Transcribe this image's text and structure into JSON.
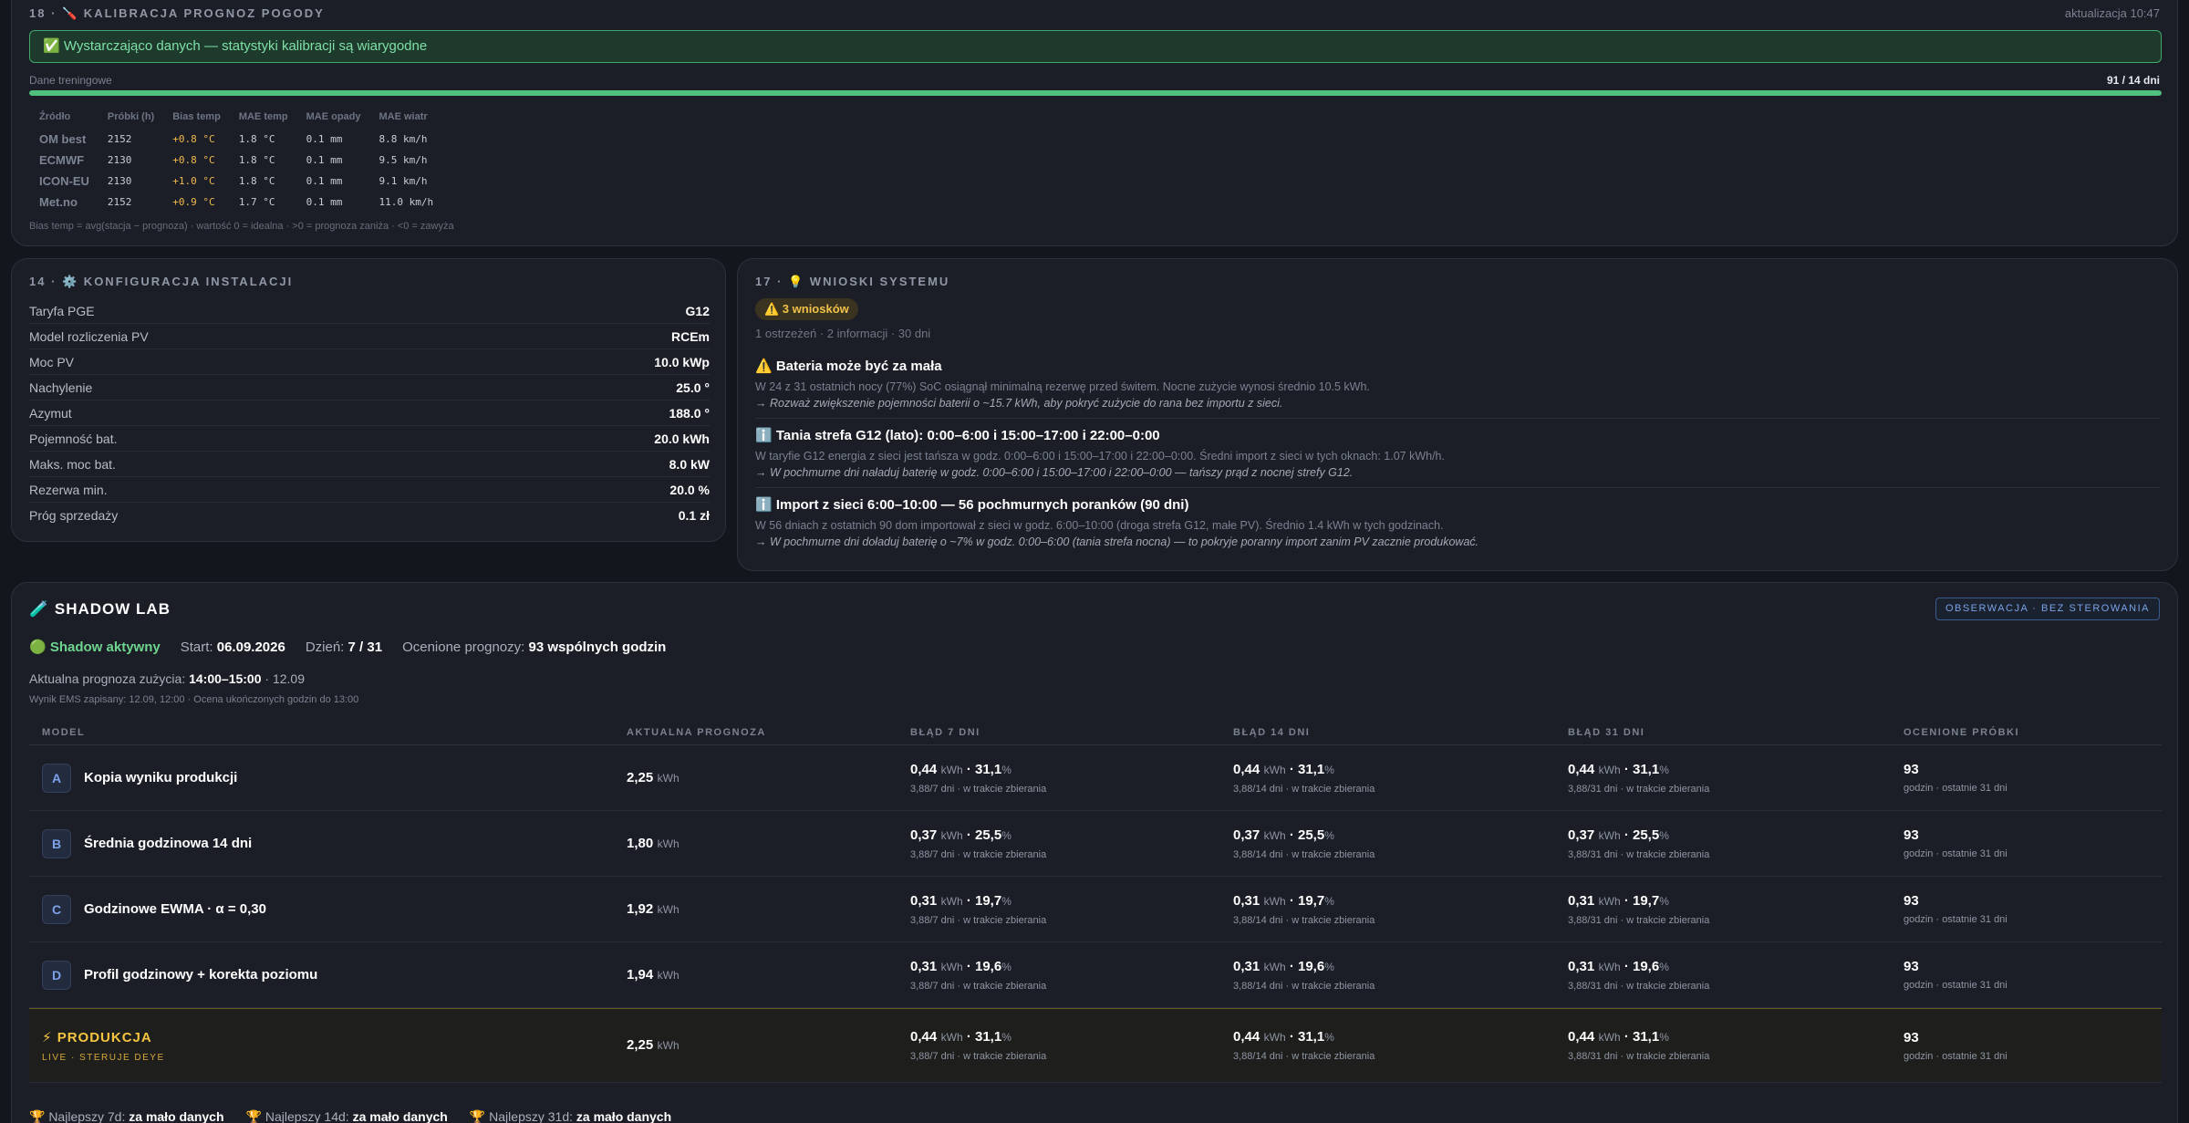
{
  "calibration": {
    "title": "18 · 🪛 KALIBRACJA PROGNOZ POGODY",
    "updated": "aktualizacja 10:47",
    "banner": "✅ Wystarczająco danych — statystyki kalibracji są wiarygodne",
    "training_label": "Dane treningowe",
    "training_value": "91 / 14 dni",
    "training_progress": 1.0,
    "columns": [
      "Źródło",
      "Próbki (h)",
      "Bias temp",
      "MAE temp",
      "MAE opady",
      "MAE wiatr"
    ],
    "rows": [
      {
        "source": "OM best",
        "samples": "2152",
        "bias": "+0.8 °C",
        "mae_temp": "1.8 °C",
        "mae_rain": "0.1 mm",
        "mae_wind": "8.8 km/h"
      },
      {
        "source": "ECMWF",
        "samples": "2130",
        "bias": "+0.8 °C",
        "mae_temp": "1.8 °C",
        "mae_rain": "0.1 mm",
        "mae_wind": "9.5 km/h"
      },
      {
        "source": "ICON-EU",
        "samples": "2130",
        "bias": "+1.0 °C",
        "mae_temp": "1.8 °C",
        "mae_rain": "0.1 mm",
        "mae_wind": "9.1 km/h"
      },
      {
        "source": "Met.no",
        "samples": "2152",
        "bias": "+0.9 °C",
        "mae_temp": "1.7 °C",
        "mae_rain": "0.1 mm",
        "mae_wind": "11.0 km/h"
      }
    ],
    "footnote": "Bias temp = avg(stacja − prognoza) · wartość 0 = idealna · >0 = prognoza zaniża · <0 = zawyża"
  },
  "config": {
    "title": "14 · ⚙️ KONFIGURACJA INSTALACJI",
    "rows": [
      {
        "key": "Taryfa PGE",
        "value": "G12"
      },
      {
        "key": "Model rozliczenia PV",
        "value": "RCEm"
      },
      {
        "key": "Moc PV",
        "value": "10.0 kWp"
      },
      {
        "key": "Nachylenie",
        "value": "25.0 °"
      },
      {
        "key": "Azymut",
        "value": "188.0 °"
      },
      {
        "key": "Pojemność bat.",
        "value": "20.0 kWh"
      },
      {
        "key": "Maks. moc bat.",
        "value": "8.0 kW"
      },
      {
        "key": "Rezerwa min.",
        "value": "20.0 %"
      },
      {
        "key": "Próg sprzedaży",
        "value": "0.1 zł"
      }
    ]
  },
  "insights": {
    "title": "17 · 💡 WNIOSKI SYSTEMU",
    "badge": "⚠️ 3 wniosków",
    "subtitle": "1 ostrzeżeń · 2 informacji · 30 dni",
    "items": [
      {
        "heading": "⚠️ Bateria może być za mała",
        "detail": "W 24 z 31 ostatnich nocy (77%) SoC osiągnął minimalną rezerwę przed świtem. Nocne zużycie wynosi średnio 10.5 kWh.",
        "advice": "→ Rozważ zwiększenie pojemności baterii o ~15.7 kWh, aby pokryć zużycie do rana bez importu z sieci."
      },
      {
        "heading": "ℹ️ Tania strefa G12 (lato): 0:00–6:00 i 15:00–17:00 i 22:00–0:00",
        "detail": "W taryfie G12 energia z sieci jest tańsza w godz. 0:00–6:00 i 15:00–17:00 i 22:00–0:00. Średni import z sieci w tych oknach: 1.07 kWh/h.",
        "advice": "→ W pochmurne dni naładuj baterię w godz. 0:00–6:00 i 15:00–17:00 i 22:00–0:00 — tańszy prąd z nocnej strefy G12."
      },
      {
        "heading": "ℹ️ Import z sieci 6:00–10:00 — 56 pochmurnych poranków (90 dni)",
        "detail": "W 56 dniach z ostatnich 90 dom importował z sieci w godz. 6:00–10:00 (droga strefa G12, małe PV). Średnio 1.4 kWh w tych godzinach.",
        "advice": "→ W pochmurne dni doładuj baterię o ~7% w godz. 0:00–6:00 (tania strefa nocna) — to pokryje poranny import zanim PV zacznie produkować."
      }
    ]
  },
  "shadow_lab": {
    "title": "🧪 SHADOW LAB",
    "mode_badge": "OBSERWACJA · BEZ STEROWANIA",
    "status": "🟢 Shadow aktywny",
    "start_label": "Start:",
    "start_value": "06.09.2026",
    "day_label": "Dzień:",
    "day_value": "7 / 31",
    "rated_label": "Ocenione prognozy:",
    "rated_value": "93 wspólnych godzin",
    "forecast_label": "Aktualna prognoza zużycia:",
    "forecast_window": "14:00–15:00",
    "forecast_date": "· 12.09",
    "ems_note": "Wynik EMS zapisany: 12.09, 12:00 · Ocena ukończonych godzin do 13:00",
    "columns": [
      "MODEL",
      "AKTUALNA PROGNOZA",
      "BŁĄD 7 DNI",
      "BŁĄD 14 DNI",
      "BŁĄD 31 DNI",
      "OCENIONE PRÓBKI"
    ],
    "unit": "kWh",
    "models": [
      {
        "letter": "A",
        "name": "Kopia wyniku produkcji",
        "forecast": "2,25",
        "e7": "0,44",
        "p7": "31,1",
        "s7": "3,88/7 dni · w trakcie zbierania",
        "e14": "0,44",
        "p14": "31,1",
        "s14": "3,88/14 dni · w trakcie zbierania",
        "e31": "0,44",
        "p31": "31,1",
        "s31": "3,88/31 dni · w trakcie zbierania",
        "samples": "93",
        "samples_sub": "godzin · ostatnie 31 dni"
      },
      {
        "letter": "B",
        "name": "Średnia godzinowa 14 dni",
        "forecast": "1,80",
        "e7": "0,37",
        "p7": "25,5",
        "s7": "3,88/7 dni · w trakcie zbierania",
        "e14": "0,37",
        "p14": "25,5",
        "s14": "3,88/14 dni · w trakcie zbierania",
        "e31": "0,37",
        "p31": "25,5",
        "s31": "3,88/31 dni · w trakcie zbierania",
        "samples": "93",
        "samples_sub": "godzin · ostatnie 31 dni"
      },
      {
        "letter": "C",
        "name": "Godzinowe EWMA · α = 0,30",
        "forecast": "1,92",
        "e7": "0,31",
        "p7": "19,7",
        "s7": "3,88/7 dni · w trakcie zbierania",
        "e14": "0,31",
        "p14": "19,7",
        "s14": "3,88/14 dni · w trakcie zbierania",
        "e31": "0,31",
        "p31": "19,7",
        "s31": "3,88/31 dni · w trakcie zbierania",
        "samples": "93",
        "samples_sub": "godzin · ostatnie 31 dni"
      },
      {
        "letter": "D",
        "name": "Profil godzinowy + korekta poziomu",
        "forecast": "1,94",
        "e7": "0,31",
        "p7": "19,6",
        "s7": "3,88/7 dni · w trakcie zbierania",
        "e14": "0,31",
        "p14": "19,6",
        "s14": "3,88/14 dni · w trakcie zbierania",
        "e31": "0,31",
        "p31": "19,6",
        "s31": "3,88/31 dni · w trakcie zbierania",
        "samples": "93",
        "samples_sub": "godzin · ostatnie 31 dni"
      }
    ],
    "production": {
      "name": "⚡ PRODUKCJA",
      "sub": "LIVE · STERUJE DEYE",
      "forecast": "2,25",
      "e7": "0,44",
      "p7": "31,1",
      "s7": "3,88/7 dni · w trakcie zbierania",
      "e14": "0,44",
      "p14": "31,1",
      "s14": "3,88/14 dni · w trakcie zbierania",
      "e31": "0,44",
      "p31": "31,1",
      "s31": "3,88/31 dni · w trakcie zbierania",
      "samples": "93",
      "samples_sub": "godzin · ostatnie 31 dni"
    },
    "best": [
      {
        "label": "🏆 Najlepszy 7d:",
        "value": "za mało danych"
      },
      {
        "label": "🏆 Najlepszy 14d:",
        "value": "za mało danych"
      },
      {
        "label": "🏆 Najlepszy 31d:",
        "value": "za mało danych"
      }
    ]
  },
  "colors": {
    "accent_green": "#4fc07e",
    "warning": "#f1c24a",
    "info": "#7aa2e6",
    "production": "#f5c542"
  }
}
